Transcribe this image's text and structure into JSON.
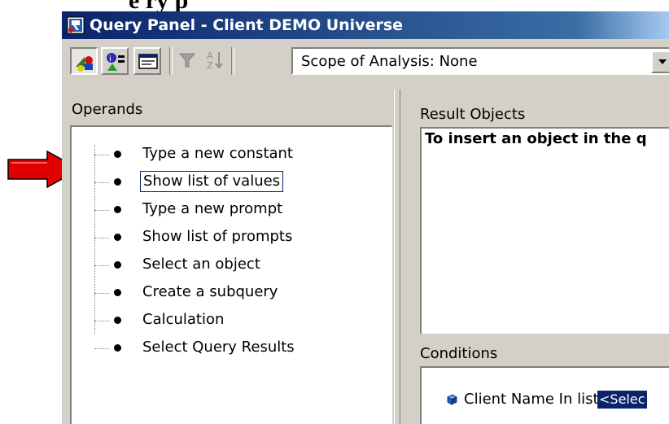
{
  "overlay": {
    "heading_fragment": "e    ry   p",
    "arrow_color": "#e00000"
  },
  "window": {
    "title": "Query Panel - Client DEMO Universe",
    "title_icon": "query-panel-icon"
  },
  "toolbar": {
    "buttons": [
      {
        "icon": "classes-objects-icon",
        "pressed": true
      },
      {
        "icon": "predefined-conditions-icon",
        "pressed": false
      },
      {
        "icon": "sql-view-icon",
        "pressed": false
      },
      {
        "icon": "filter-icon",
        "pressed": false,
        "disabled": true
      },
      {
        "icon": "sort-icon",
        "pressed": false,
        "disabled": true
      }
    ],
    "scope_select": {
      "value": "Scope of Analysis: None"
    }
  },
  "operands": {
    "label": "Operands",
    "items": [
      {
        "label": "Type a new constant",
        "selected": false
      },
      {
        "label": "Show list of values",
        "selected": true
      },
      {
        "label": "Type a new prompt",
        "selected": false
      },
      {
        "label": "Show list of prompts",
        "selected": false
      },
      {
        "label": "Select an object",
        "selected": false
      },
      {
        "label": "Create a subquery",
        "selected": false
      },
      {
        "label": "Calculation",
        "selected": false
      },
      {
        "label": "Select Query Results",
        "selected": false
      }
    ]
  },
  "result_objects": {
    "label": "Result Objects",
    "hint": "To insert an object in the q"
  },
  "conditions": {
    "label": "Conditions",
    "items": [
      {
        "icon": "condition-cube-icon",
        "text": "Client Name In list",
        "operand": "<Selec"
      }
    ]
  }
}
